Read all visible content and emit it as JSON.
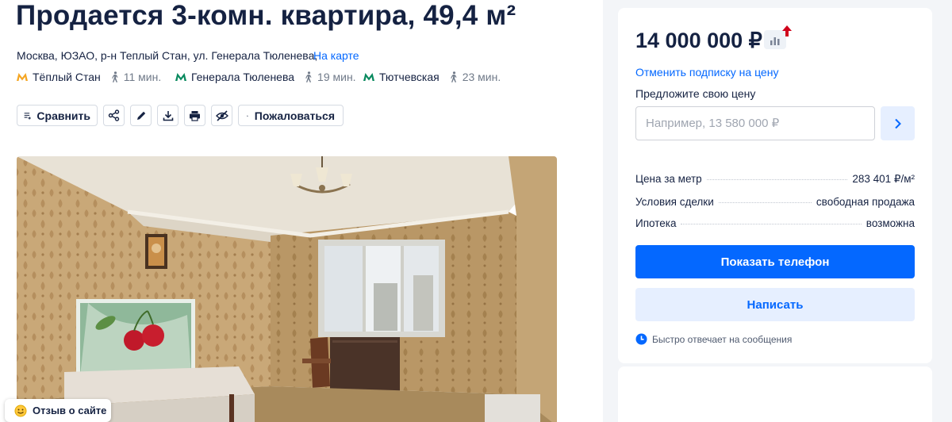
{
  "listing": {
    "title": "Продается 3-комн. квартира, 49,4 м²",
    "address": "Москва, ЮЗАО, р-н Теплый Стан, ул. Генерала Тюленева,",
    "map_link": "На карте",
    "metro": [
      {
        "name": "Тёплый Стан",
        "minutes": "11 мин.",
        "color": "#f5a623"
      },
      {
        "name": "Генерала Тюленева",
        "minutes": "19 мин.",
        "color": "#0a8a5f"
      },
      {
        "name": "Тютчевская",
        "minutes": "23 мин.",
        "color": "#0a8a5f"
      }
    ]
  },
  "toolbar": {
    "compare_label": "Сравнить",
    "complain_label": "Пожаловаться"
  },
  "feedback": {
    "label": "Отзыв о сайте"
  },
  "price_card": {
    "price": "14 000 000 ₽",
    "unsubscribe": "Отменить подписку на цену",
    "suggest_label": "Предложите свою цену",
    "suggest_placeholder": "Например, 13 580 000 ₽",
    "details": [
      {
        "label": "Цена за метр",
        "value": "283 401 ₽/м²"
      },
      {
        "label": "Условия сделки",
        "value": "свободная продажа"
      },
      {
        "label": "Ипотека",
        "value": "возможна"
      }
    ],
    "phone_button": "Показать телефон",
    "write_button": "Написать",
    "quick_reply": "Быстро отвечает на сообщения"
  },
  "colors": {
    "accent": "#0468ff",
    "accent_light": "#e6efff",
    "text": "#152242",
    "price_up": "#d0021b"
  }
}
